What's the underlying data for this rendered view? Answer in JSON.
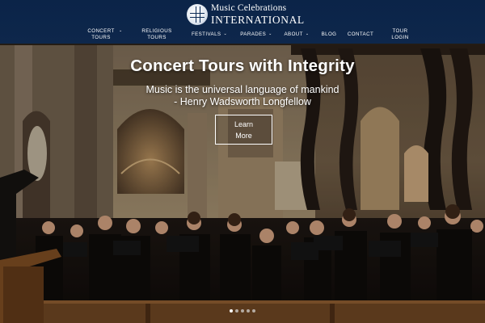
{
  "brand": {
    "name_line1": "Music Celebrations",
    "name_line2": "International",
    "icon": "globe-logo-icon"
  },
  "nav": {
    "items": [
      {
        "label": "Concert Tours",
        "has_dropdown": true
      },
      {
        "label": "Religious Tours",
        "has_dropdown": false
      },
      {
        "label": "Festivals",
        "has_dropdown": true
      },
      {
        "label": "Parades",
        "has_dropdown": true
      },
      {
        "label": "About",
        "has_dropdown": true
      },
      {
        "label": "Blog",
        "has_dropdown": false
      },
      {
        "label": "Contact",
        "has_dropdown": false
      },
      {
        "label": "Tour Login",
        "has_dropdown": false
      }
    ],
    "chevron_icon": "chevron-down-icon"
  },
  "hero": {
    "title": "Concert Tours with Integrity",
    "quote_line1": "Music is the universal language of mankind",
    "quote_line2": "- Henry Wadsworth Longfellow",
    "cta_line1": "Learn",
    "cta_line2": "More",
    "slides_total": 5,
    "active_slide": 1
  },
  "colors": {
    "header_bg": "#0c2850",
    "text": "#ffffff"
  }
}
